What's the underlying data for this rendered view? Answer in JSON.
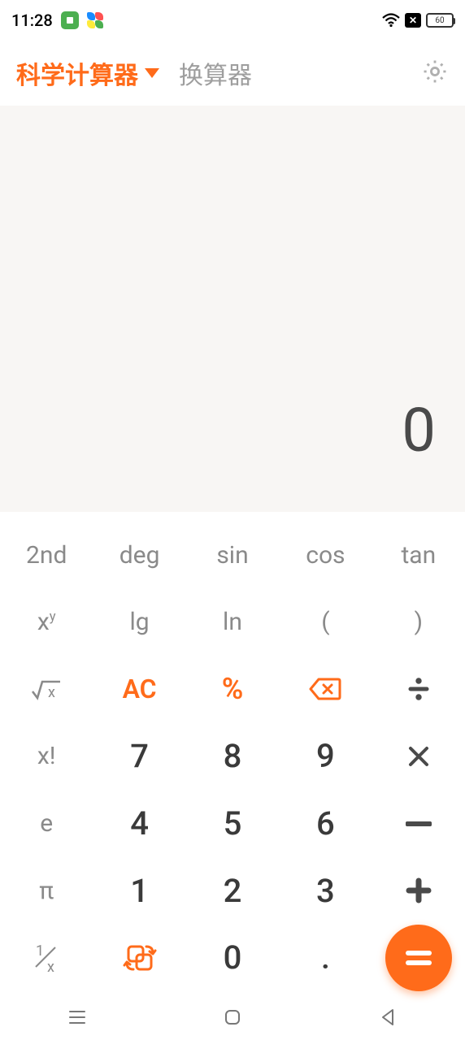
{
  "status": {
    "time": "11:28",
    "battery": "60"
  },
  "tabs": {
    "scientific": "科学计算器",
    "converter": "换算器"
  },
  "display": {
    "value": "0"
  },
  "keys": {
    "second": "2nd",
    "deg": "deg",
    "sin": "sin",
    "cos": "cos",
    "tan": "tan",
    "xy": "x",
    "xy_sup": "y",
    "lg": "lg",
    "ln": "ln",
    "lparen": "(",
    "rparen": ")",
    "sqrt": "√x",
    "ac": "AC",
    "percent": "%",
    "xfact": "x!",
    "seven": "7",
    "eight": "8",
    "nine": "9",
    "e": "e",
    "four": "4",
    "five": "5",
    "six": "6",
    "pi": "π",
    "one": "1",
    "two": "2",
    "three": "3",
    "oneoverx_num": "1",
    "oneoverx_den": "x",
    "zero": "0",
    "dot": ".",
    "equals": "="
  }
}
